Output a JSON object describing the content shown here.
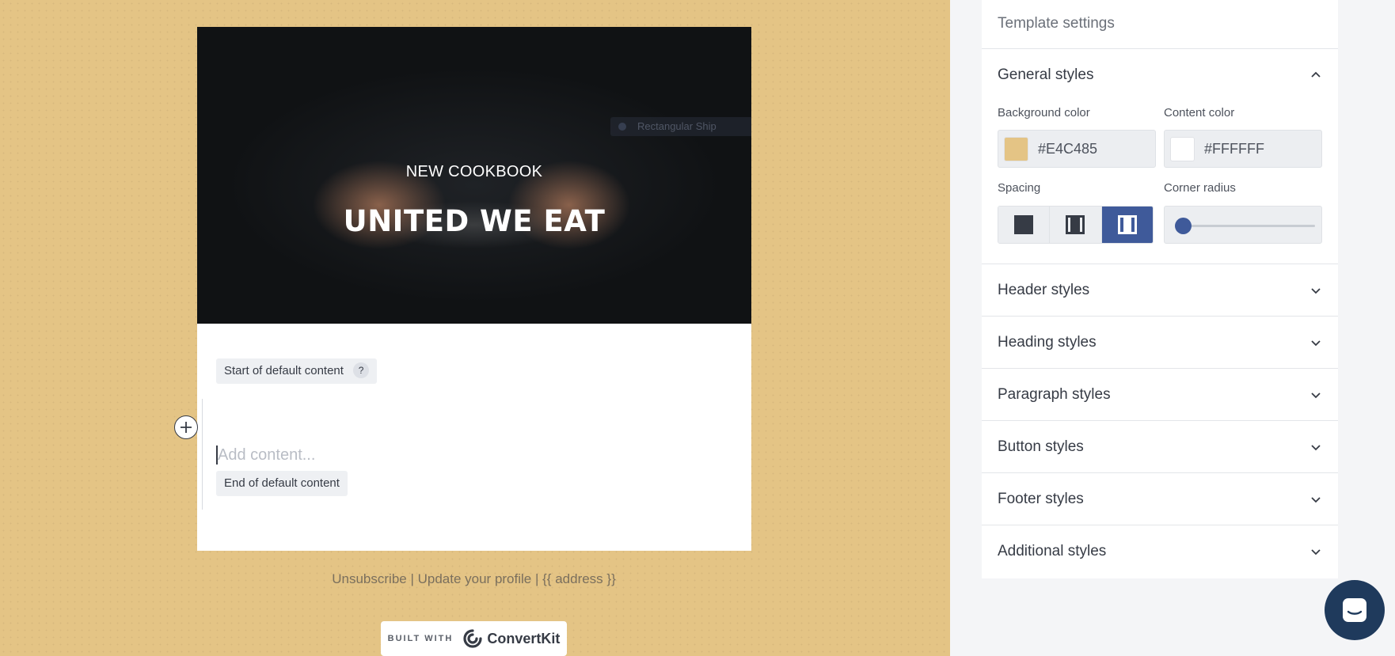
{
  "canvas": {
    "background_color": "#e4c485",
    "hero": {
      "eyebrow": "NEW COOKBOOK",
      "title": "UNITED WE EAT",
      "ghost_chip": "Rectangular Ship"
    },
    "content": {
      "start_marker": "Start of default content",
      "help_badge": "?",
      "placeholder": "Add content...",
      "end_marker": "End of default content"
    },
    "footer": {
      "unsubscribe": "Unsubscribe",
      "sep1": " | ",
      "update_profile": "Update your profile",
      "sep2": " | ",
      "address": "{{ address }}"
    },
    "badge": {
      "built_with": "BUILT WITH",
      "brand": "ConvertKit"
    }
  },
  "panel": {
    "title": "Template settings",
    "general": {
      "label": "General styles",
      "background_color_label": "Background color",
      "background_color_value": "#E4C485",
      "content_color_label": "Content color",
      "content_color_value": "#FFFFFF",
      "spacing_label": "Spacing",
      "corner_radius_label": "Corner radius",
      "spacing_selected": 3,
      "corner_radius_value": 0
    },
    "sections": [
      {
        "label": "Header styles"
      },
      {
        "label": "Heading styles"
      },
      {
        "label": "Paragraph styles"
      },
      {
        "label": "Button styles"
      },
      {
        "label": "Footer styles"
      },
      {
        "label": "Additional styles"
      }
    ]
  },
  "colors": {
    "accent": "#3f5a9a",
    "text": "#363b45",
    "chat": "#1f3a5c"
  }
}
